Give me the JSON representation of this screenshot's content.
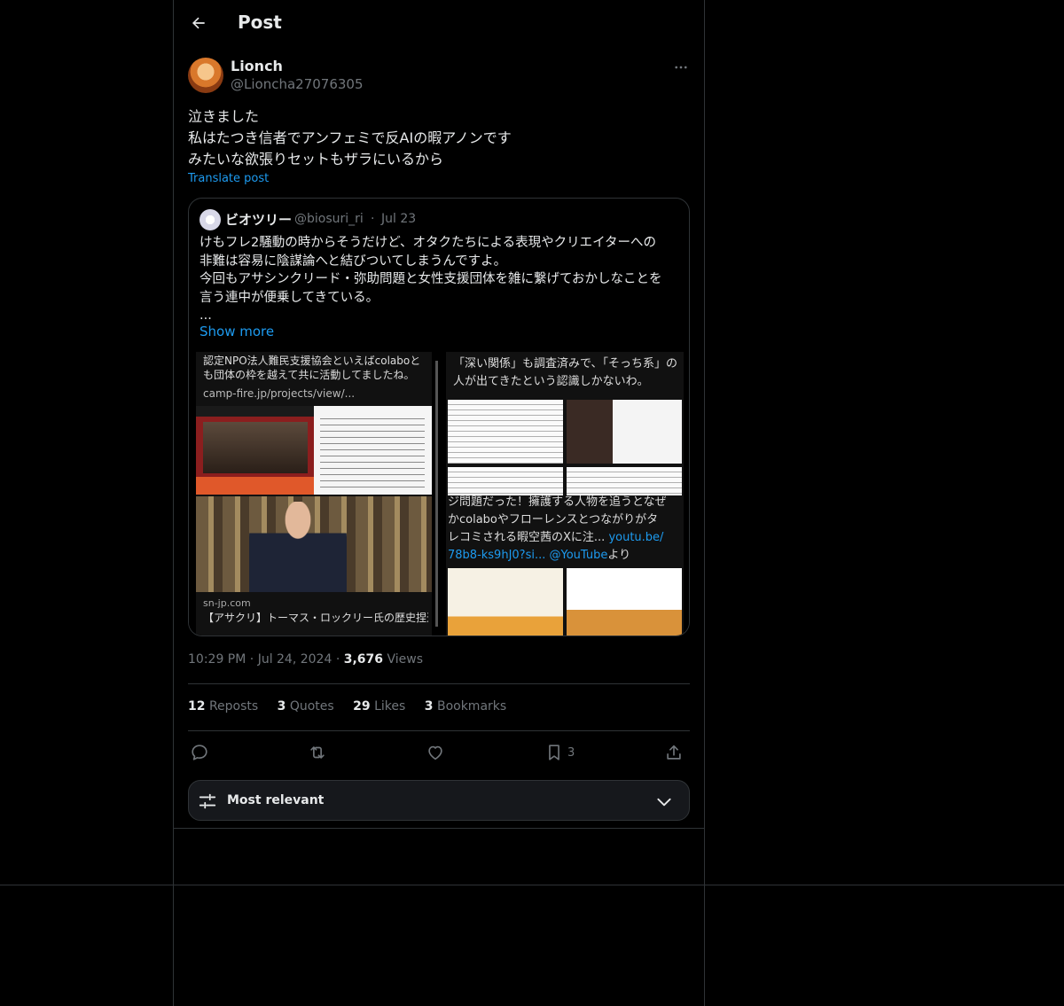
{
  "header": {
    "title": "Post"
  },
  "post": {
    "author": {
      "name": "Lionch",
      "handle": "@Lioncha27076305"
    },
    "text_lines": [
      "泣きました",
      "私はたつき信者でアンフェミで反AIの暇アノンです",
      "みたいな欲張りセットもザラにいるから"
    ],
    "translate_label": "Translate post",
    "quote": {
      "name": "ビオツリー",
      "handle": "@biosuri_ri",
      "separator": "·",
      "date": "Jul 23",
      "text_lines": [
        "けもフレ2騒動の時からそうだけど、オタクたちによる表現やクリエイターへの",
        "非難は容易に陰謀論へと結びついてしまうんですよ。",
        "今回もアサシンクリード・弥助問題と女性支援団体を雑に繋げておかしなことを",
        "言う連中が便乗してきている。",
        "..."
      ],
      "show_more": "Show more",
      "media_a": {
        "text": "認定NPO法人難民支援協会といえばcolaboとも団体の枠を越えて共に活動してましたね。",
        "link": "camp-fire.jp/projects/view/...",
        "domain": "sn-jp.com",
        "caption": "【アサクリ】トーマス・ロックリー氏の歴史捏造問題　支持していたNPO法人が『Colabo』と繋がっ"
      },
      "media_b": {
        "text": "「深い関係」も調査済みで、「そっち系」の人が出てきたという認識しかないわ。",
        "text2_lines": [
          "ジ問題だった！擁護する人物を追うとなぜ",
          "かcolaboやフローレンスとつながりがタ",
          "レコミされる暇空茜のXに注..."
        ],
        "link_url": "youtu.be/",
        "link_url2": "78b8-ks9hJ0?si...",
        "link_mention": "@YouTube",
        "yori": "より"
      }
    },
    "time": "10:29 PM",
    "dot": "·",
    "date": "Jul 24, 2024",
    "views_count": "3,676",
    "views_label": "Views",
    "stats": {
      "reposts": "12",
      "reposts_label": "Reposts",
      "quotes": "3",
      "quotes_label": "Quotes",
      "likes": "29",
      "likes_label": "Likes",
      "bookmarks": "3",
      "bookmarks_label": "Bookmarks"
    },
    "actions": {
      "bookmark_count": "3"
    }
  },
  "replies_sort": {
    "label": "Most relevant"
  },
  "colors": {
    "background": "#000000",
    "text": "#e7e9ea",
    "secondary": "#71767b",
    "link": "#1d9bf0",
    "border": "#2f3336"
  }
}
